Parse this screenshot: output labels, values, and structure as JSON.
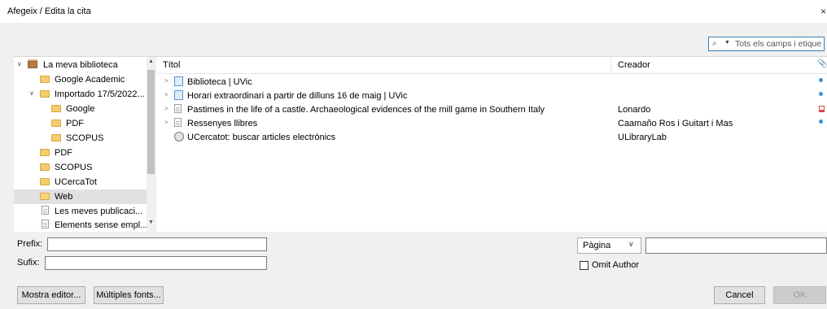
{
  "window": {
    "title": "Afegeix / Edita la cita",
    "close_glyph": "×"
  },
  "search": {
    "value": "Tots els camps i etique",
    "icon": "search-icon",
    "mode_icon": "dropdown-arrow-icon"
  },
  "tree": {
    "items": [
      {
        "label": "La meva biblioteca",
        "icon": "library-icon"
      },
      {
        "label": "Google Academic",
        "icon": "folder-icon"
      },
      {
        "label": "Importado 17/5/2022...",
        "icon": "folder-icon"
      },
      {
        "label": "Google",
        "icon": "folder-icon"
      },
      {
        "label": "PDF",
        "icon": "folder-icon"
      },
      {
        "label": "SCOPUS",
        "icon": "folder-icon"
      },
      {
        "label": "PDF",
        "icon": "folder-icon"
      },
      {
        "label": "SCOPUS",
        "icon": "folder-icon"
      },
      {
        "label": "UCercaTot",
        "icon": "folder-icon"
      },
      {
        "label": "Web",
        "icon": "folder-icon",
        "selected": true
      },
      {
        "label": "Les meves publicaci...",
        "icon": "publications-icon"
      },
      {
        "label": "Elements sense empl...",
        "icon": "unfiled-icon"
      }
    ]
  },
  "items": {
    "columns": {
      "title": "Títol",
      "creator": "Creador"
    },
    "rows": [
      {
        "title": "Biblioteca | UVic",
        "creator": "",
        "type": "web-page-icon",
        "attachment": "snapshot-icon"
      },
      {
        "title": "Horari extraordinari a partir de dilluns 16 de maig | UVic",
        "creator": "",
        "type": "web-page-icon",
        "attachment": "snapshot-icon"
      },
      {
        "title": "Pastimes in the life of a castle. Archaeological evidences of the mill game in Southern Italy",
        "creator": "Lonardo",
        "type": "document-icon",
        "attachment": "pdf-icon"
      },
      {
        "title": "Ressenyes llibres",
        "creator": "Caamaño Ros i Guitart i Mas",
        "type": "document-icon",
        "attachment": "snapshot-icon"
      },
      {
        "title": "UCercatot: buscar articles electrònics",
        "creator": "ULibraryLab",
        "type": "library-catalog-icon",
        "attachment": ""
      }
    ]
  },
  "citation": {
    "prefix_label": "Prefix:",
    "prefix_value": "",
    "suffix_label": "Sufix:",
    "suffix_value": "",
    "locator_type": "Pàgina",
    "locator_value": "",
    "omit_author_label": "Omit Author",
    "omit_author_checked": false
  },
  "buttons": {
    "show_editor": "Mostra editor...",
    "multiple_sources": "Múltiples fonts...",
    "cancel": "Cancel",
    "ok": "OK"
  }
}
